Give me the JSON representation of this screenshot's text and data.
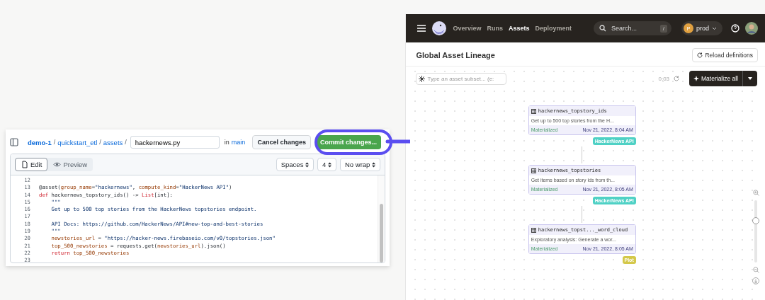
{
  "editor": {
    "breadcrumb": [
      {
        "label": "demo-1",
        "bold": true
      },
      {
        "label": "quickstart_etl",
        "bold": false
      },
      {
        "label": "assets",
        "bold": false
      }
    ],
    "path_separator": "/",
    "file_name": "hackernews.py",
    "branch_prefix": "in",
    "branch": "main",
    "cancel_button": "Cancel changes",
    "commit_button": "Commit changes...",
    "tabs": [
      {
        "label": "Edit",
        "selected": true
      },
      {
        "label": "Preview",
        "selected": false
      }
    ],
    "selects": [
      "Spaces",
      "4",
      "No wrap"
    ],
    "lines": [
      {
        "number": "12"
      },
      {
        "number": "13",
        "segments": [
          {
            "text": "@asset(",
            "kind": "plain"
          },
          {
            "text": "group_name",
            "kind": "var"
          },
          {
            "text": "=",
            "kind": "plain"
          },
          {
            "text": "\"hackernews\"",
            "kind": "string"
          },
          {
            "text": ", ",
            "kind": "plain"
          },
          {
            "text": "compute_kind",
            "kind": "var"
          },
          {
            "text": "=",
            "kind": "plain"
          },
          {
            "text": "\"HackerNews API\"",
            "kind": "string"
          },
          {
            "text": ")",
            "kind": "plain"
          }
        ]
      },
      {
        "number": "14",
        "segments": [
          {
            "text": "def",
            "kind": "keyword"
          },
          {
            "text": " hackernews_topstory_ids() -> ",
            "kind": "plain"
          },
          {
            "text": "List",
            "kind": "keyword"
          },
          {
            "text": "[int]:",
            "kind": "plain"
          }
        ]
      },
      {
        "number": "15",
        "segments": [
          {
            "text": "    \"\"\"",
            "kind": "doc"
          }
        ]
      },
      {
        "number": "16",
        "segments": [
          {
            "text": "    Get up to 500 top stories from the HackerNews topstories endpoint.",
            "kind": "doc"
          }
        ]
      },
      {
        "number": "17"
      },
      {
        "number": "18",
        "segments": [
          {
            "text": "    API Docs: https://github.com/HackerNews/API#new-top-and-best-stories",
            "kind": "doc"
          }
        ]
      },
      {
        "number": "19",
        "segments": [
          {
            "text": "    \"\"\"",
            "kind": "doc"
          }
        ]
      },
      {
        "number": "20",
        "segments": [
          {
            "text": "    newstories_url",
            "kind": "var"
          },
          {
            "text": " = ",
            "kind": "plain"
          },
          {
            "text": "\"https://hacker-news.firebaseio.com/v0/topstories.json\"",
            "kind": "string"
          }
        ]
      },
      {
        "number": "21",
        "segments": [
          {
            "text": "    top_500_newstories",
            "kind": "var"
          },
          {
            "text": " = requests.get(",
            "kind": "plain"
          },
          {
            "text": "newstories_url",
            "kind": "var"
          },
          {
            "text": ").json()",
            "kind": "plain"
          }
        ]
      },
      {
        "number": "22",
        "segments": [
          {
            "text": "    return",
            "kind": "keyword"
          },
          {
            "text": " top_500_newstories",
            "kind": "var"
          }
        ]
      },
      {
        "number": "23"
      }
    ]
  },
  "app": {
    "nav": [
      {
        "label": "Overview",
        "selected": false
      },
      {
        "label": "Runs",
        "selected": false
      },
      {
        "label": "Assets",
        "selected": true
      },
      {
        "label": "Deployment",
        "selected": false
      }
    ],
    "search": {
      "placeholder": "Search...",
      "shortcut": "/"
    },
    "deployment": {
      "initial": "P",
      "label": "prod"
    },
    "page_title": "Global Asset Lineage",
    "reload_button": "Reload definitions",
    "filter": {
      "placeholder": "Type an asset subset... (e:"
    },
    "refresh_time": "0:03",
    "materialize_button": "Materialize all",
    "nodes": [
      {
        "name": "hackernews_topstory_ids",
        "description": "Get up to 500 top stories from the H...",
        "status": "Materialized",
        "time": "Nov 21, 2022, 8:04 AM",
        "tag": "HackerNews API",
        "color": "#4fd1c5"
      },
      {
        "name": "hackernews_topstories",
        "description": "Get items based on story ids from th...",
        "status": "Materialized",
        "time": "Nov 21, 2022, 8:05 AM",
        "tag": "HackerNews API",
        "color": "#4fd1c5"
      },
      {
        "name": "hackernews_topst..._word_cloud",
        "description": "Exploratory analysis: Generate a wor...",
        "status": "Materialized",
        "time": "Nov 21, 2022, 8:05 AM",
        "tag": "Plot",
        "color": "#d4c84a"
      }
    ],
    "zoom": {
      "level": 0.67
    }
  }
}
